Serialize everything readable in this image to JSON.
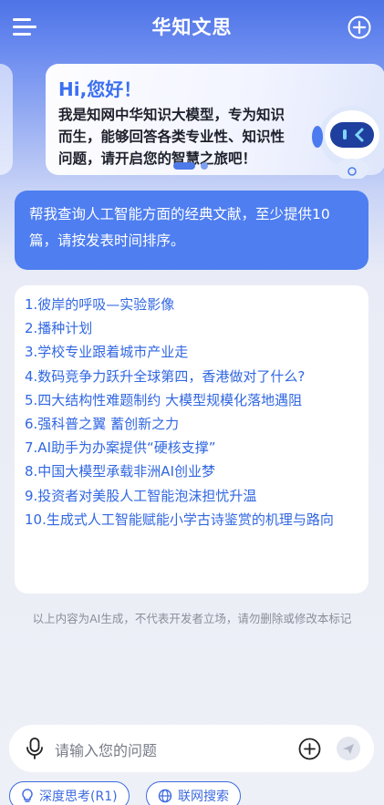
{
  "header": {
    "title": "华知文思"
  },
  "banner": {
    "greeting": "Hi,您好！",
    "intro_lines": [
      "我是知网中华知识大模型，专为知识",
      "而生，能够回答各类专业性、知识性",
      "问题，请开启您的智慧之旅吧！"
    ]
  },
  "chat": {
    "user_message_lines": [
      "帮我查询人工智能方面的经典文献，至少提供10",
      "篇，请按发表时间排序。"
    ],
    "answer_items": [
      "1.彼岸的呼吸—实验影像",
      "2.播种计划",
      "3.学校专业跟着城市产业走",
      "4.数码竞争力跃升全球第四，香港做对了什么?",
      "5.四大结构性难题制约 大模型规模化落地遇阻",
      "6.强科普之翼 蓄创新之力",
      "7.AI助手为办案提供“硬核支撑”",
      "8.中国大模型承载非洲AI创业梦",
      "9.投资者对美股人工智能泡沫担忧升温",
      "10.生成式人工智能赋能小学古诗鉴赏的机理与路向"
    ],
    "disclaimer": "以上内容为AI生成，不代表开发者立场，请勿删除或修改本标记"
  },
  "input": {
    "placeholder": "请输入您的问题"
  },
  "chips": {
    "deep_think": "深度思考(R1)",
    "web_search": "联网搜索"
  },
  "colors": {
    "accent": "#4e7ef0",
    "link": "#3167e2",
    "header_gradient_top": "#4d73e6"
  },
  "icons": {
    "menu": "menu-icon",
    "new_chat": "plus-circle-icon",
    "mic": "microphone-icon",
    "attach": "plus-circle-icon",
    "send": "send-icon",
    "deep_think": "lightbulb-icon",
    "web_search": "globe-icon"
  }
}
